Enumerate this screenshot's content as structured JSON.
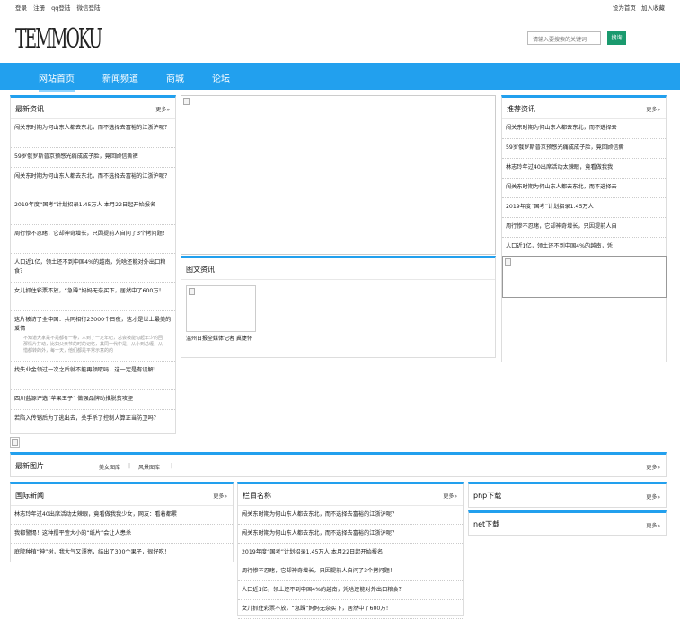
{
  "topbar": {
    "login": "登录",
    "register": "注册",
    "qq": "qq登陆",
    "wechat": "微信登陆",
    "set_home": "设为首页",
    "favorite": "加入收藏"
  },
  "logo": "TEMMOKU",
  "search": {
    "placeholder": "请输入要搜索的关键词",
    "button": "搜询"
  },
  "nav": [
    "网站首页",
    "新闻频道",
    "商城",
    "论坛"
  ],
  "latest": {
    "title": "最新资讯",
    "more": "更多",
    "items": [
      "闯关东时期为何山东人都去东北，而不选择去富裕的江浙沪呢？",
      "59岁俄罗斯普京预感光痛成成子脸，竟回顾信撕裤",
      "闯关东时期为何山东人都去东北，而不选择去富裕的江浙沪呢？",
      "2019年度“国考”计划招录1.45万人 本月22日起开始报名",
      "周行惨不忍睹，它却神奇增长，只因提前人自问了3个拷问题！",
      "人口近1亿，领土还不到中国4%的越南，凭啥还能对外出口粮食？",
      "女儿抓住彩票不放，“急躁”妈妈无奈买下，居然中了600万！",
      "这片被访了全中国：共同相行23000个日夜，这才是世上最美的爱情"
    ],
    "quote": "不知道大家是不是都有一种，人到了一定年纪，总会被能勾起年少的回那情片打动，比如父亲节的时的记忆，其同一代中是，从小到总缠，从惜都转的外，每一天，他们都是平常示意的的",
    "items2": [
      "找失业金领过一次之后就不能再领取吗，这一定是有误解！",
      "四川盐源评选“苹果王子” 做强品牌助推脱贫攻坚",
      "若陷入传销后为了逃出去，关手杀了控制人算正当防卫吗？"
    ]
  },
  "tuwen": {
    "title": "图文资讯",
    "caption": "温州日报全媒体记者 冀婕怀"
  },
  "recommend": {
    "title": "推荐资讯",
    "more": "更多",
    "items": [
      "闯关东时期为何山东人都去东北，而不选择去",
      "59岁俄罗斯普京预感光痛成成子脸，竟回顾信撕",
      "林志玲年过40出席活动太辣眼，竟看做我我",
      "闯关东时期为何山东人都去东北，而不选择去",
      "2019年度“国考”计划招录1.45万人",
      "周行惨不忍睹，它却神奇增长，只因提前人自",
      "人口近1亿，领土还不到中国4%的越南，凭"
    ]
  },
  "photos": {
    "title": "最新图片",
    "tabs": [
      "美女图库",
      "风景图库"
    ],
    "more": "更多"
  },
  "intl": {
    "title": "国际新闻",
    "more": "更多",
    "items": [
      "林志玲年过40出席活动太辣眼，竟看做我我少女，网友：看着都累",
      "我都警惕！这种摆平萱大小的“纸片”会让人患杀",
      "庭院种植“神”树，我大气又漂亮，结出了300个果子，很好吃！"
    ]
  },
  "column": {
    "title": "栏目名称",
    "more": "更多",
    "items": [
      "闯关东时期为何山东人都去东北，而不选择去富裕的江浙沪呢？",
      "闯关东时期为何山东人都去东北，而不选择去富裕的江浙沪呢？",
      "2019年度“国考”计划招录1.45万人 本月22日起开始报名",
      "周行惨不忍睹，它却神奇增长，只因提前人自问了3个拷问题！",
      "人口近1亿，领土还不到中国4%的越南，凭啥还能对外出口粮食？",
      "女儿抓住彩票不放，“急躁”妈妈无奈买下，居然中了600万！"
    ]
  },
  "php": {
    "title": "php下载",
    "more": "更多"
  },
  "net": {
    "title": "net下载",
    "more": "更多"
  },
  "colors": {
    "accent": "#22a0ee",
    "search_button": "#1a9a6e"
  }
}
